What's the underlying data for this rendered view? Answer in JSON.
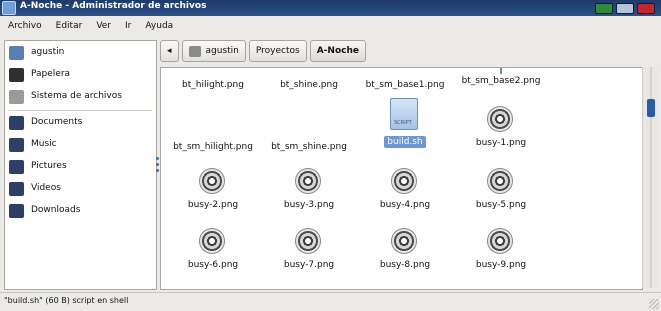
{
  "window": {
    "title": "A-Noche - Administrador de archivos",
    "controls": [
      "minimize-button",
      "maximize-button",
      "close-button"
    ],
    "colors": {
      "minimize": "#2e8b3a",
      "maximize": "#b7c4d6",
      "close": "#c0282c"
    }
  },
  "menubar": {
    "items": [
      {
        "label": "Archivo"
      },
      {
        "label": "Editar"
      },
      {
        "label": "Ver"
      },
      {
        "label": "Ir"
      },
      {
        "label": "Ayuda"
      }
    ]
  },
  "sidebar": {
    "items": [
      {
        "label": "agustin",
        "icon": "home-icon",
        "color": "#5a7fb4"
      },
      {
        "label": "Papelera",
        "icon": "trash-icon",
        "color": "#2f2f2f"
      },
      {
        "label": "Sistema de archivos",
        "icon": "drive-icon",
        "color": "#9a9a9a"
      },
      {
        "label": "Documents",
        "icon": "documents-folder-icon",
        "color": "#2c3f66"
      },
      {
        "label": "Music",
        "icon": "music-folder-icon",
        "color": "#2c3f66"
      },
      {
        "label": "Pictures",
        "icon": "pictures-folder-icon",
        "color": "#2c3f66"
      },
      {
        "label": "Videos",
        "icon": "videos-folder-icon",
        "color": "#2c3f66"
      },
      {
        "label": "Downloads",
        "icon": "downloads-folder-icon",
        "color": "#2c3f66"
      }
    ]
  },
  "pathbar": {
    "back_icon": "chevron-left-icon",
    "crumbs": [
      {
        "label": "agustin"
      },
      {
        "label": "Proyectos"
      },
      {
        "label": "A-Noche"
      }
    ]
  },
  "files": [
    {
      "name": "bt_hilight.png",
      "type": "partial"
    },
    {
      "name": "bt_shine.png",
      "type": "partial"
    },
    {
      "name": "bt_sm_base1.png",
      "type": "partial"
    },
    {
      "name": "bt_sm_base2.png",
      "type": "partial"
    },
    {
      "name": "bt_sm_hilight.png",
      "type": "blank"
    },
    {
      "name": "bt_sm_shine.png",
      "type": "blank"
    },
    {
      "name": "build.sh",
      "type": "script",
      "selected": true,
      "icon_text": "SCRIPT"
    },
    {
      "name": "busy-1.png",
      "type": "gear"
    },
    {
      "name": "busy-2.png",
      "type": "gear"
    },
    {
      "name": "busy-3.png",
      "type": "gear"
    },
    {
      "name": "busy-4.png",
      "type": "gear"
    },
    {
      "name": "busy-5.png",
      "type": "gear"
    },
    {
      "name": "busy-6.png",
      "type": "gear"
    },
    {
      "name": "busy-7.png",
      "type": "gear"
    },
    {
      "name": "busy-8.png",
      "type": "gear"
    },
    {
      "name": "busy-9.png",
      "type": "gear"
    }
  ],
  "statusbar": {
    "text": "\"build.sh\" (60 B) script en shell"
  }
}
